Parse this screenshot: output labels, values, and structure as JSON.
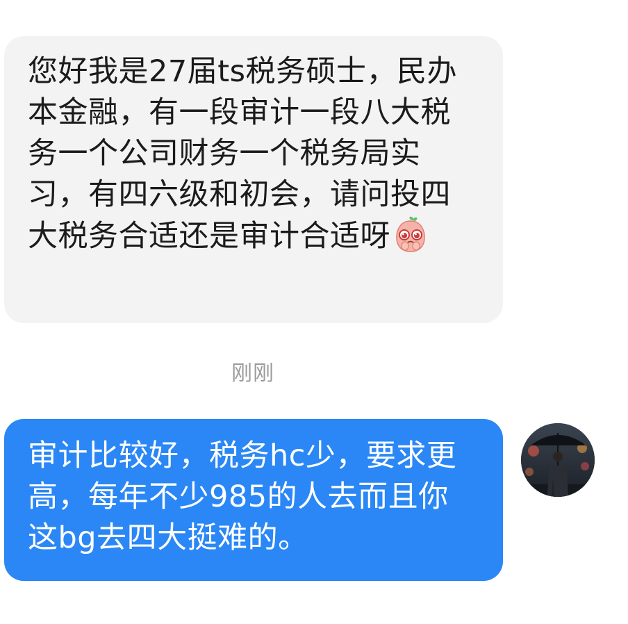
{
  "messages": [
    {
      "direction": "incoming",
      "text": "您好我是27届ts税务硕士，民办本金融，有一段审计一段八大税务一个公司财务一个税务局实习，有四六级和初会，请问投四大税务合适还是审计合适呀",
      "emoji": "pleading-face-icon"
    },
    {
      "direction": "outgoing",
      "text": "审计比较好，税务hc少，要求更高，每年不少985的人去而且你这bg去四大挺难的。"
    }
  ],
  "timestamp": "刚刚",
  "colors": {
    "incoming_bubble": "#f3f3f3",
    "outgoing_bubble": "#2a87f5",
    "timestamp_text": "#9b9b9b"
  }
}
